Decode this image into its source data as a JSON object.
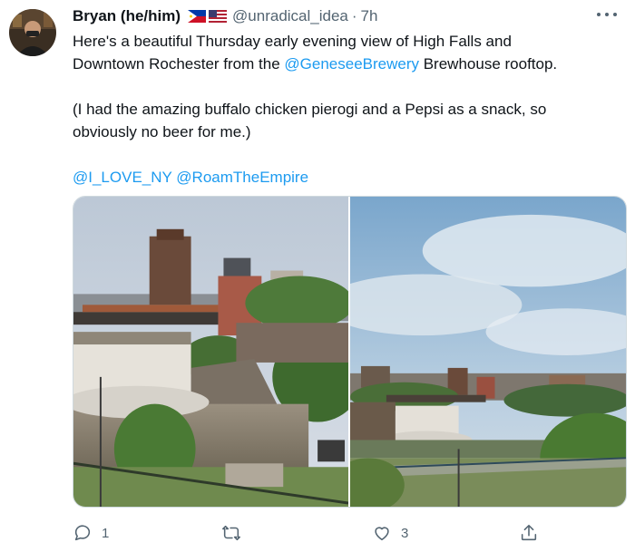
{
  "tweet": {
    "display_name": "Bryan (he/him)",
    "flags": [
      "philippines-flag-icon",
      "us-flag-icon"
    ],
    "handle": "@unradical_idea",
    "separator": "·",
    "time": "7h",
    "text": {
      "line1": "Here's a beautiful Thursday early evening view of High Falls and",
      "line2_pre": "Downtown Rochester from the ",
      "line2_mention": "@GeneseeBrewery",
      "line2_post": " Brewhouse rooftop.",
      "line3": "(I had the amazing buffalo chicken pierogi and a Pepsi as a snack, so",
      "line4": "obviously no beer for me.)",
      "mention1": "@I_LOVE_NY",
      "mention2": "@RoamTheEmpire"
    },
    "actions": {
      "reply_count": "1",
      "retweet_count": "",
      "like_count": "3"
    }
  },
  "colors": {
    "link": "#1d9bf0",
    "secondary_text": "#536471",
    "primary_text": "#0f1419"
  }
}
